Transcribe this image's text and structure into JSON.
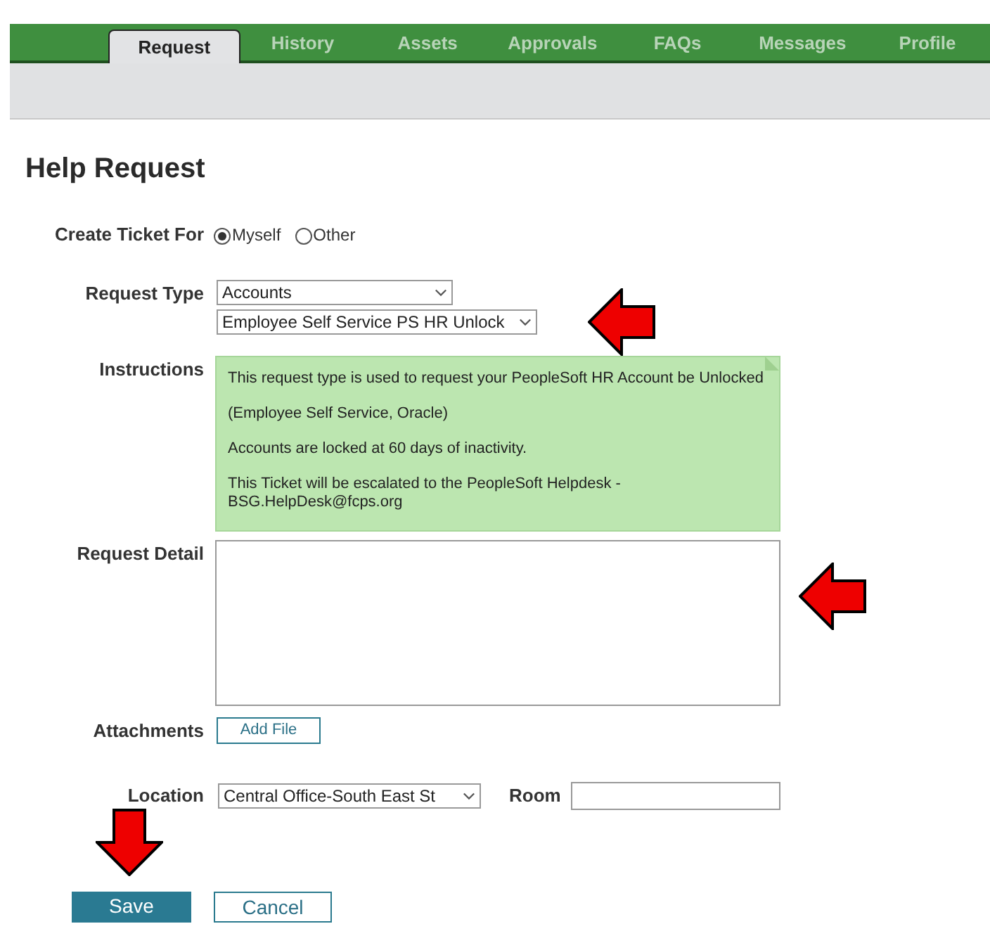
{
  "tabs": [
    {
      "label": "Request",
      "selected": true
    },
    {
      "label": "History",
      "selected": false
    },
    {
      "label": "Assets",
      "selected": false
    },
    {
      "label": "Approvals",
      "selected": false
    },
    {
      "label": "FAQs",
      "selected": false
    },
    {
      "label": "Messages",
      "selected": false
    },
    {
      "label": "Profile",
      "selected": false
    }
  ],
  "title": "Help Request",
  "create_ticket_for": {
    "label": "Create Ticket For",
    "options": [
      {
        "label": "Myself",
        "selected": true
      },
      {
        "label": "Other",
        "selected": false
      }
    ]
  },
  "request_type": {
    "label": "Request Type",
    "value": "Accounts",
    "subtype": "Employee Self Service PS HR Unlock"
  },
  "instructions": {
    "label": "Instructions",
    "paragraphs": [
      "This request type is used to request your PeopleSoft HR Account be Unlocked",
      "(Employee Self Service, Oracle)",
      "Accounts are locked at 60 days of inactivity.",
      "This Ticket will be escalated to the PeopleSoft Helpdesk -\nBSG.HelpDesk@fcps.org"
    ]
  },
  "request_detail": {
    "label": "Request Detail"
  },
  "attachments": {
    "label": "Attachments",
    "button": "Add File"
  },
  "location": {
    "label": "Location",
    "value": "Central Office-South East St"
  },
  "room": {
    "label": "Room"
  },
  "buttons": [
    {
      "label": "Save",
      "kind": "primary"
    },
    {
      "label": "Cancel",
      "kind": "secondary"
    }
  ],
  "annotations": [
    {
      "kind": "arrow_left"
    },
    {
      "kind": "arrow_left"
    },
    {
      "kind": "arrow_down"
    }
  ]
}
